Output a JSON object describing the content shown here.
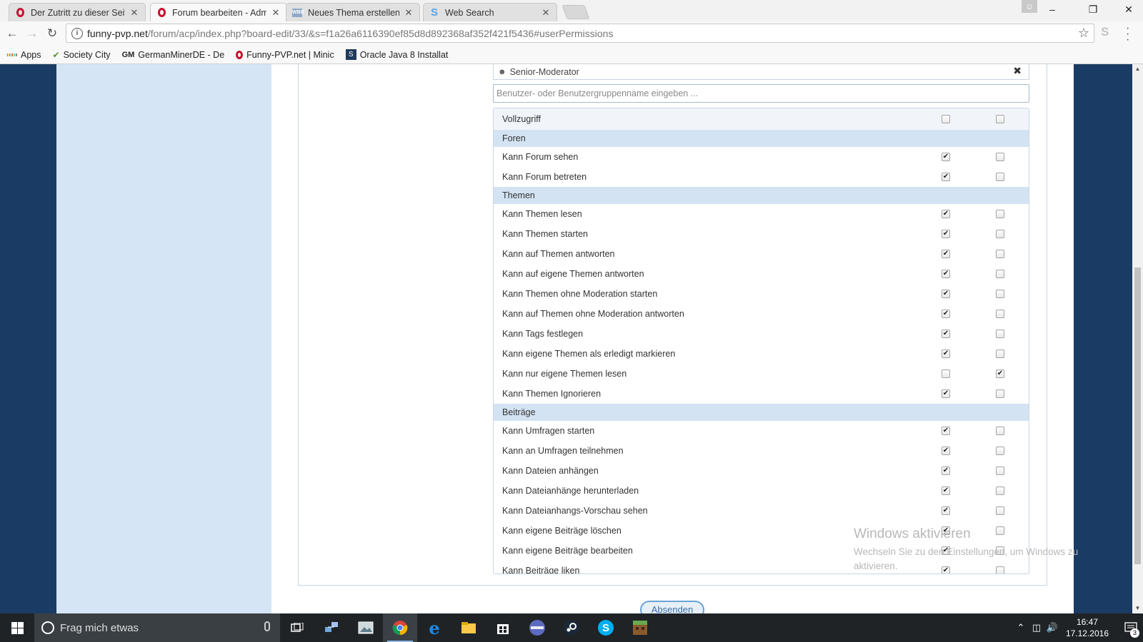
{
  "browser": {
    "tabs": [
      {
        "title": "Der Zutritt zu dieser Seit",
        "icon": "opera-icon",
        "active": false
      },
      {
        "title": "Forum bearbeiten - Adm",
        "icon": "opera-icon",
        "active": true
      },
      {
        "title": "Neues Thema erstellen -",
        "icon": "wbb-icon",
        "active": false
      },
      {
        "title": "Web Search",
        "icon": "search-s-icon",
        "active": false
      }
    ],
    "window_buttons": {
      "minimize": "–",
      "restore": "❐",
      "close": "✕"
    },
    "address": {
      "host": "funny-pvp.net",
      "path": "/forum/acp/index.php?board-edit/33/&s=f1a26a6116390ef85d8d892368af352f421f5436#userPermissions"
    },
    "bookmarks": [
      {
        "label": "Apps",
        "icon": "apps-grid-icon"
      },
      {
        "label": "Society City",
        "icon": "society-icon"
      },
      {
        "label": "GermanMinerDE - De",
        "icon": "gm-icon"
      },
      {
        "label": "Funny-PVP.net | Minic",
        "icon": "opera-icon"
      },
      {
        "label": "Oracle Java 8 Installat",
        "icon": "oracle-icon"
      }
    ]
  },
  "permissions": {
    "group_name": "Senior-Moderator",
    "search_placeholder": "Benutzer- oder Benutzergruppenname eingeben ...",
    "full_access_label": "Vollzugriff",
    "full_access": [
      false,
      false
    ],
    "sections": [
      {
        "title": "Foren",
        "items": [
          {
            "label": "Kann Forum sehen",
            "values": [
              true,
              false
            ]
          },
          {
            "label": "Kann Forum betreten",
            "values": [
              true,
              false
            ]
          }
        ]
      },
      {
        "title": "Themen",
        "items": [
          {
            "label": "Kann Themen lesen",
            "values": [
              true,
              false
            ]
          },
          {
            "label": "Kann Themen starten",
            "values": [
              true,
              false
            ]
          },
          {
            "label": "Kann auf Themen antworten",
            "values": [
              true,
              false
            ]
          },
          {
            "label": "Kann auf eigene Themen antworten",
            "values": [
              true,
              false
            ]
          },
          {
            "label": "Kann Themen ohne Moderation starten",
            "values": [
              true,
              false
            ]
          },
          {
            "label": "Kann auf Themen ohne Moderation antworten",
            "values": [
              true,
              false
            ]
          },
          {
            "label": "Kann Tags festlegen",
            "values": [
              true,
              false
            ]
          },
          {
            "label": "Kann eigene Themen als erledigt markieren",
            "values": [
              true,
              false
            ]
          },
          {
            "label": "Kann nur eigene Themen lesen",
            "values": [
              false,
              true
            ]
          },
          {
            "label": "Kann Themen Ignorieren",
            "values": [
              true,
              false
            ]
          }
        ]
      },
      {
        "title": "Beiträge",
        "items": [
          {
            "label": "Kann Umfragen starten",
            "values": [
              true,
              false
            ]
          },
          {
            "label": "Kann an Umfragen teilnehmen",
            "values": [
              true,
              false
            ]
          },
          {
            "label": "Kann Dateien anhängen",
            "values": [
              true,
              false
            ]
          },
          {
            "label": "Kann Dateianhänge herunterladen",
            "values": [
              true,
              false
            ]
          },
          {
            "label": "Kann Dateianhangs-Vorschau sehen",
            "values": [
              true,
              false
            ]
          },
          {
            "label": "Kann eigene Beiträge löschen",
            "values": [
              true,
              false
            ]
          },
          {
            "label": "Kann eigene Beiträge bearbeiten",
            "values": [
              true,
              false
            ]
          },
          {
            "label": "Kann Beiträge liken",
            "values": [
              true,
              false
            ]
          }
        ]
      }
    ],
    "submit_label": "Absenden"
  },
  "watermark": {
    "title": "Windows aktivieren",
    "text": "Wechseln Sie zu den Einstellungen, um Windows zu aktivieren."
  },
  "taskbar": {
    "search_placeholder": "Frag mich etwas",
    "apps": [
      "task-view-icon",
      "network-app-icon",
      "photos-icon",
      "chrome-icon",
      "edge-icon",
      "file-explorer-icon",
      "store-icon",
      "media-app-icon",
      "steam-icon",
      "skype-icon",
      "minecraft-icon"
    ],
    "time": "16:47",
    "date": "17.12.2016",
    "notification_count": "3"
  },
  "colors": {
    "page_background": "#1a3b63",
    "sidebar": "#d5e5f6",
    "section_header": "#d4e3f3",
    "taskbar": "#1f2326"
  }
}
